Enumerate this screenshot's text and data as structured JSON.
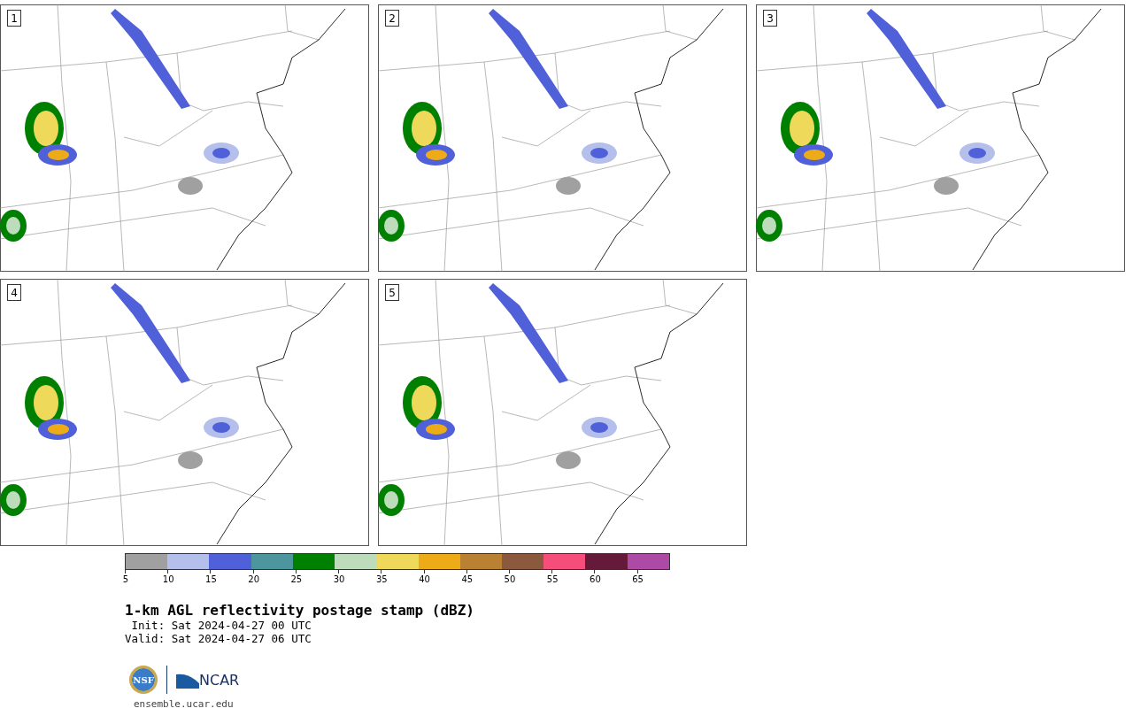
{
  "panels": [
    {
      "label": "1"
    },
    {
      "label": "2"
    },
    {
      "label": "3"
    },
    {
      "label": "4"
    },
    {
      "label": "5"
    }
  ],
  "colorbar": {
    "segments": [
      {
        "color": "#a0a0a0"
      },
      {
        "color": "#b4bfeb"
      },
      {
        "color": "#5060d8"
      },
      {
        "color": "#4e969e"
      },
      {
        "color": "#008000"
      },
      {
        "color": "#bddcbc"
      },
      {
        "color": "#efd95a"
      },
      {
        "color": "#eeab18"
      },
      {
        "color": "#b98131"
      },
      {
        "color": "#8b5a3e"
      },
      {
        "color": "#f54e7a"
      },
      {
        "color": "#651a3a"
      },
      {
        "color": "#ac4aa6"
      }
    ],
    "ticks": [
      "5",
      "10",
      "15",
      "20",
      "25",
      "30",
      "35",
      "40",
      "45",
      "50",
      "55",
      "60",
      "65"
    ]
  },
  "title": "1-km AGL reflectivity postage stamp (dBZ)",
  "init": " Init: Sat 2024-04-27 00 UTC",
  "valid": "Valid: Sat 2024-04-27 06 UTC",
  "logo": {
    "nsf": "NSF",
    "ncar": "NCAR"
  },
  "footer": "ensemble.ucar.edu"
}
